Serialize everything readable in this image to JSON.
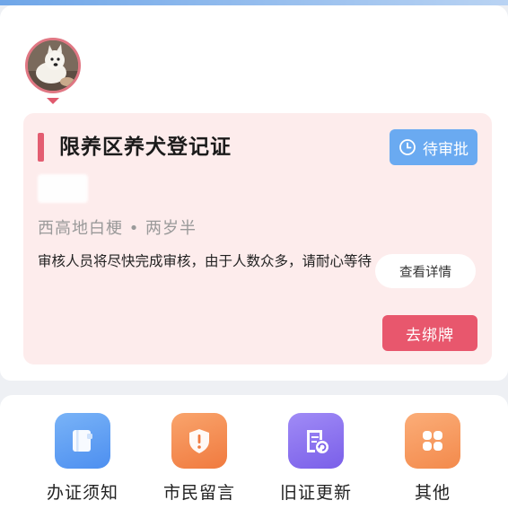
{
  "profile": {
    "avatar_icon": "dog-avatar"
  },
  "card": {
    "title": "限养区养犬登记证",
    "status_label": "待审批",
    "status_icon": "clock-icon",
    "pet_desc": "西高地白梗 • 两岁半",
    "notice": "审核人员将尽快完成审核，由于人数众多，请耐心等待",
    "detail_button": "查看详情",
    "bind_button": "去绑牌",
    "colors": {
      "background": "#fdecec",
      "accent": "#e35d71",
      "status": "#6aaaf1",
      "bind": "#e8576d"
    }
  },
  "services": [
    {
      "label": "办证须知",
      "icon": "notebook-icon",
      "color": "#5b9cf0"
    },
    {
      "label": "市民留言",
      "icon": "shield-alert-icon",
      "color": "#f58d52"
    },
    {
      "label": "旧证更新",
      "icon": "refresh-doc-icon",
      "color": "#8a6ef0"
    },
    {
      "label": "其他",
      "icon": "grid-icon",
      "color": "#f59a5e"
    }
  ]
}
